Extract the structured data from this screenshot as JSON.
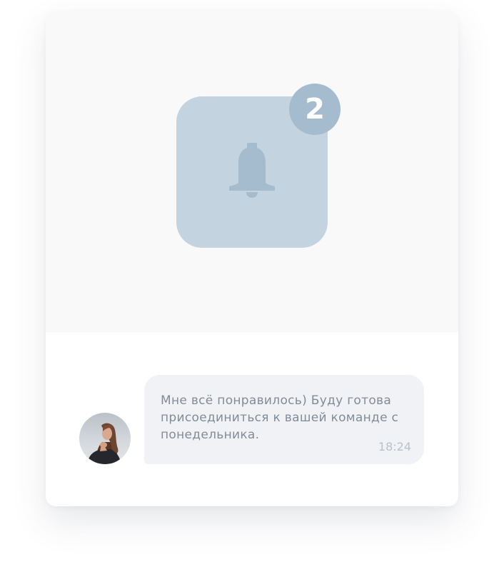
{
  "notification": {
    "badge_count": "2",
    "icon": "bell-icon"
  },
  "message": {
    "text": "Мне всё понравилось) Буду готова присоединиться к вашей команде с понедельника.",
    "time": "18:24",
    "avatar_icon": "avatar"
  },
  "colors": {
    "hero_background": "#f9f9f9",
    "tile": "#c4d3e0",
    "bell": "#a5bccf",
    "badge": "#a5bccf",
    "bubble": "#f0f2f5",
    "message_text": "#818c99",
    "time_text": "#b8c1cc"
  }
}
